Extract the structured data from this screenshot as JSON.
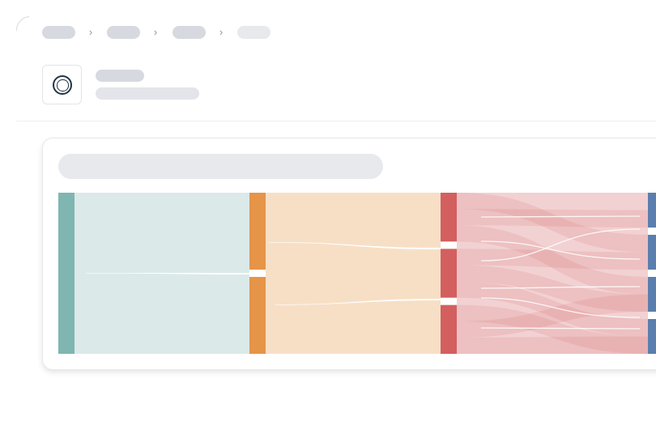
{
  "theme": {
    "skeleton": "#d6d9df",
    "skeleton_light": "#e7e9ed",
    "accent_icon": "#213547"
  },
  "header": {
    "breadcrumb_items": 4,
    "avatar_icon": "repository-ring-icon"
  },
  "chart_data": {
    "type": "sankey",
    "title": "",
    "stages": [
      {
        "color": "#7fb6b1",
        "nodes": [
          {
            "value": 100
          }
        ]
      },
      {
        "color": "#e69448",
        "nodes": [
          {
            "value": 50
          },
          {
            "value": 50
          }
        ]
      },
      {
        "color": "#d35f5f",
        "nodes": [
          {
            "value": 33
          },
          {
            "value": 33
          },
          {
            "value": 33
          }
        ]
      },
      {
        "color": "#5a7fae",
        "nodes": [
          {
            "value": 25
          },
          {
            "value": 25
          },
          {
            "value": 25
          },
          {
            "value": 25
          }
        ]
      }
    ],
    "link_colors": [
      "#dce9e9",
      "#f7dfc6",
      "#f2d1d2"
    ]
  }
}
